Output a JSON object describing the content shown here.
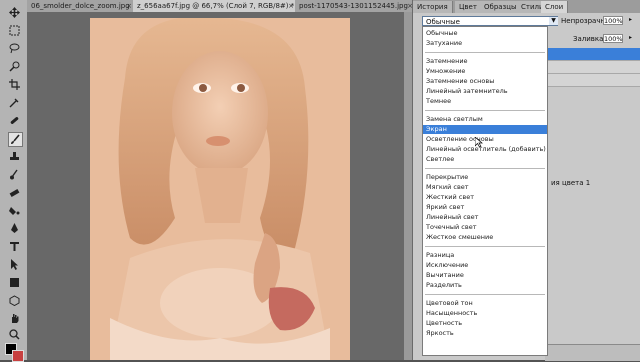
{
  "document_tabs": [
    {
      "label": "06_smolder_dolce_zoom.jpg",
      "active": false
    },
    {
      "label": "z_656aa67f.jpg @ 66,7% (Слой 7, RGB/8#) *",
      "active": true
    },
    {
      "label": "post-1170543-1301152445.jpg",
      "active": false
    }
  ],
  "panel_tabs": [
    "История",
    "Цвет",
    "Образцы",
    "Стили",
    "Слои"
  ],
  "layers": {
    "blend_mode": "Обычные",
    "opacity_label": "Непрозрачность:",
    "opacity_value": "100%",
    "fill_label": "Заливка:",
    "fill_value": "100%",
    "layer_text": "ия цвета 1"
  },
  "blend_groups": [
    [
      "Обычные",
      "Затухание"
    ],
    [
      "Затемнение",
      "Умножение",
      "Затемнение основы",
      "Линейный затемнитель",
      "Темнее"
    ],
    [
      "Замена светлым",
      "Экран",
      "Осветление основы",
      "Линейный осветлитель (добавить)",
      "Светлее"
    ],
    [
      "Перекрытие",
      "Мягкий свет",
      "Жесткий свет",
      "Яркий свет",
      "Линейный свет",
      "Точечный свет",
      "Жесткое смешение"
    ],
    [
      "Разница",
      "Исключение",
      "Вычитание",
      "Разделить"
    ],
    [
      "Цветовой тон",
      "Насыщенность",
      "Цветность",
      "Яркость"
    ]
  ],
  "selected_option": "Экран",
  "colors": {
    "highlight": "#3a7fd9",
    "foreground": "#000000",
    "background": "#c84040"
  }
}
